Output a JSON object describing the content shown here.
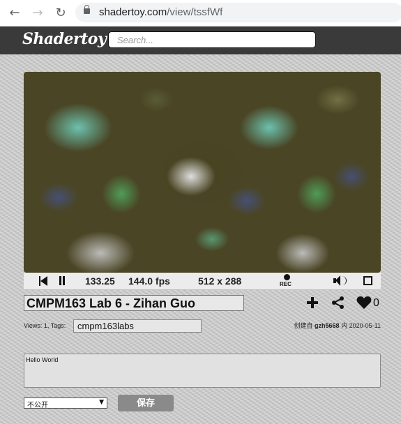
{
  "browser": {
    "url_domain": "shadertoy.com",
    "url_path": "/view/tssfWf",
    "back_icon": "back-arrow-icon",
    "forward_icon": "forward-arrow-icon",
    "reload_icon": "reload-icon"
  },
  "header": {
    "logo": "Shadertoy",
    "search_placeholder": "Search..."
  },
  "player": {
    "time": "133.25",
    "fps": "144.0 fps",
    "resolution": "512 x 288",
    "rec_label": "REC"
  },
  "shader": {
    "title": "CMPM163 Lab 6 - Zihan Guo",
    "likes": "0",
    "views": "Views: 1, Tags:",
    "tags": "cmpm163labs",
    "created_prefix": "创建自",
    "author": "gzh5668",
    "created_mid": "内",
    "date": "2020-05-11",
    "description": "Hello World"
  },
  "footer": {
    "visibility": "不公开",
    "save_label": "保存"
  }
}
